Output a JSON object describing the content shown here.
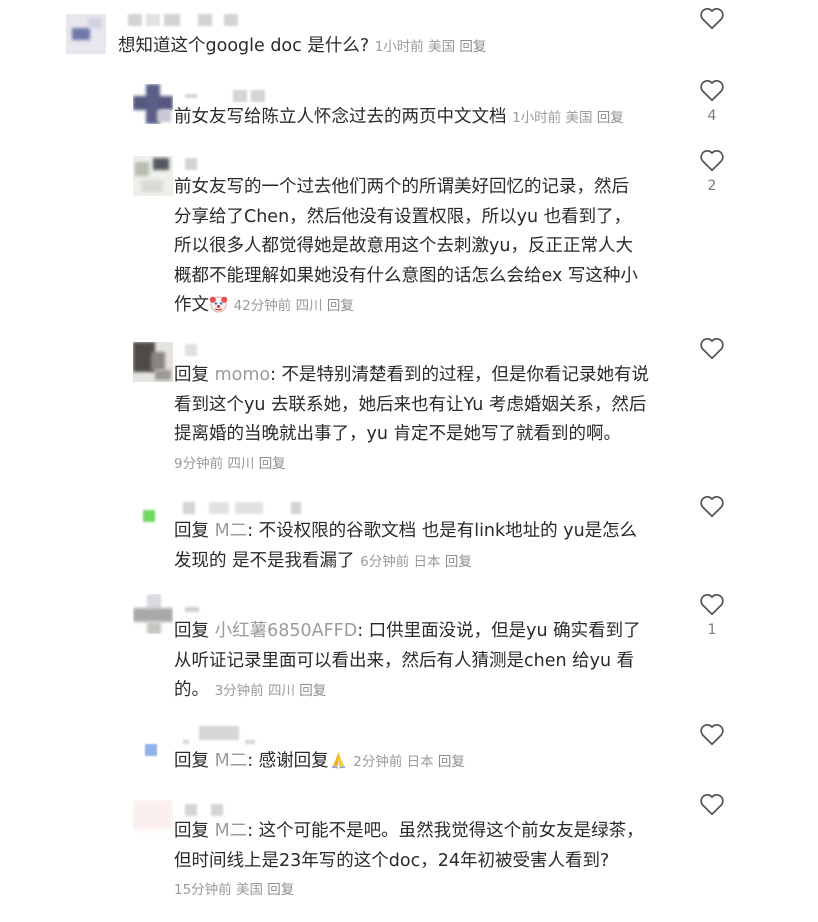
{
  "colors": {
    "text": "#2a2a2a",
    "meta": "#9a9a9a",
    "mention": "#9b9b9b"
  },
  "comments": [
    {
      "text": "想知道这个google doc 是什么?",
      "time": "1小时前",
      "location": "美国",
      "reply_label": "回复",
      "likes": ""
    },
    {
      "text": "前女友写给陈立人怀念过去的两页中文文档",
      "time": "1小时前",
      "location": "美国",
      "reply_label": "回复",
      "likes": "4"
    },
    {
      "lines": [
        "前女友写的一个过去他们两个的所谓美好回忆的记录，然后",
        "分享给了Chen，然后他没有设置权限，所以yu 也看到了，",
        "所以很多人都觉得她是故意用这个去刺激yu，反正正常人大",
        "概都不能理解如果她没有什么意图的话怎么会给ex 写这种小",
        "作文"
      ],
      "emoji": "clown-face-icon",
      "time": "42分钟前",
      "location": "四川",
      "reply_label": "回复",
      "likes": "2"
    },
    {
      "prefix": "回复 ",
      "mention": "momo",
      "lines": [
        ": 不是特别清楚看到的过程，但是你看记录她有说",
        "看到这个yu 去联系她，她后来也有让Yu 考虑婚姻关系，然后",
        "提离婚的当晚就出事了，yu 肯定不是她写了就看到的啊。"
      ],
      "time": "9分钟前",
      "location": "四川",
      "reply_label": "回复",
      "likes": ""
    },
    {
      "prefix": "回复 ",
      "mention": "M二",
      "lines": [
        ": 不设权限的谷歌文档 也是有link地址的 yu是怎么",
        "发现的 是不是我看漏了"
      ],
      "time": "6分钟前",
      "location": "日本",
      "reply_label": "回复",
      "likes": ""
    },
    {
      "prefix": "回复 ",
      "mention": "小红薯6850AFFD",
      "lines": [
        ": 口供里面没说，但是yu 确实看到了",
        "从听证记录里面可以看出来，然后有人猜测是chen 给yu 看",
        "的。"
      ],
      "time": "3分钟前",
      "location": "四川",
      "reply_label": "回复",
      "likes": "1"
    },
    {
      "prefix": "回复 ",
      "mention": "M二",
      "lines": [
        ": 感谢回复"
      ],
      "emoji": "folded-hands-icon",
      "time": "2分钟前",
      "location": "日本",
      "reply_label": "回复",
      "likes": ""
    },
    {
      "prefix": "回复 ",
      "mention": "M二",
      "lines": [
        ": 这个可能不是吧。虽然我觉得这个前女友是绿茶，",
        "但时间线上是23年写的这个doc，24年初被受害人看到?"
      ],
      "time": "15分钟前",
      "location": "美国",
      "reply_label": "回复",
      "likes": ""
    }
  ]
}
